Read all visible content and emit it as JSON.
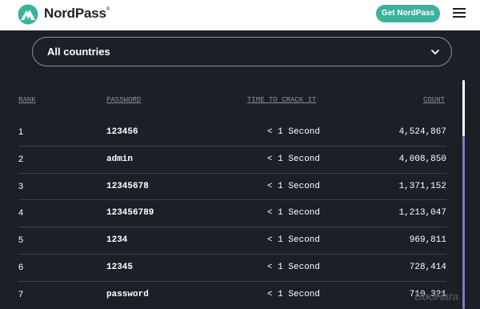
{
  "header": {
    "brand": "NordPass",
    "brand_mark": "®",
    "cta_label": "Get NordPass",
    "logo_icon": "nordpass-mountain-logo",
    "menu_icon": "hamburger-menu-icon"
  },
  "filter": {
    "selected": "All countries",
    "icon": "chevron-down-icon"
  },
  "table": {
    "headers": {
      "rank": "RANK",
      "password": "PASSWORD",
      "time": "TIME TO CRACK IT",
      "count": "COUNT"
    },
    "rows": [
      {
        "rank": "1",
        "password": "123456",
        "time": "< 1 Second",
        "count": "4,524,867"
      },
      {
        "rank": "2",
        "password": "admin",
        "time": "< 1 Second",
        "count": "4,008,850"
      },
      {
        "rank": "3",
        "password": "12345678",
        "time": "< 1 Second",
        "count": "1,371,152"
      },
      {
        "rank": "4",
        "password": "123456789",
        "time": "< 1 Second",
        "count": "1,213,047"
      },
      {
        "rank": "5",
        "password": "1234",
        "time": "< 1 Second",
        "count": "969,811"
      },
      {
        "rank": "6",
        "password": "12345",
        "time": "< 1 Second",
        "count": "728,414"
      },
      {
        "rank": "7",
        "password": "password",
        "time": "< 1 Second",
        "count": "710,321"
      }
    ]
  },
  "watermark": "BooHara",
  "colors": {
    "background": "#1c1f26",
    "accent": "#3bb39c",
    "divider": "#3d414b",
    "scrollbar": "#7e7bb9"
  }
}
